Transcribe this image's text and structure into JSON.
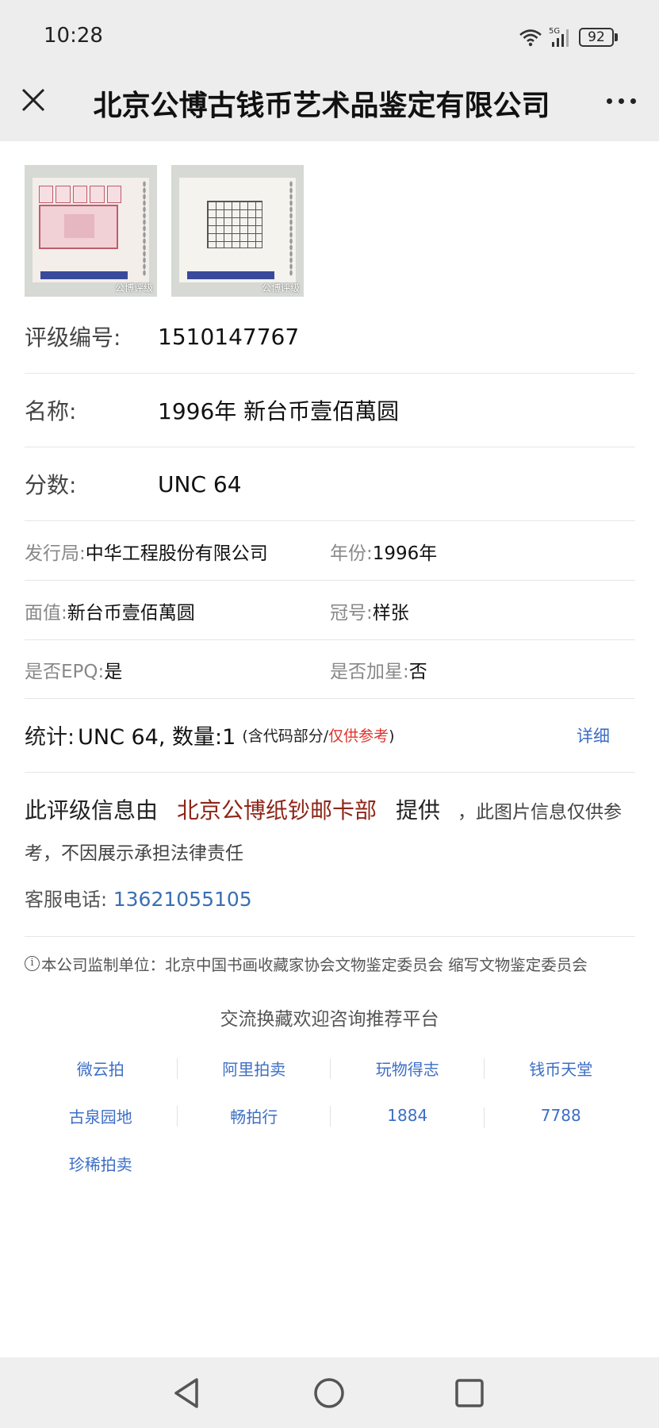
{
  "status_bar": {
    "time": "10:28",
    "network": "5G",
    "battery": "92"
  },
  "nav": {
    "title": "北京公博古钱币艺术品鉴定有限公司",
    "close_icon": "close-icon",
    "more_icon": "more-icon"
  },
  "thumbnails": [
    {
      "watermark": "公博评级"
    },
    {
      "watermark": "公博评级"
    }
  ],
  "main": {
    "grade_no_label": "评级编号:",
    "grade_no": "1510147767",
    "name_label": "名称:",
    "name": "1996年 新台币壹佰萬圆",
    "score_label": "分数:",
    "score": "UNC 64"
  },
  "details": {
    "issuer_label": "发行局:",
    "issuer": "中华工程股份有限公司",
    "year_label": "年份:",
    "year": "1996年",
    "denom_label": "面值:",
    "denom": "新台币壹佰萬圆",
    "serial_label": "冠号:",
    "serial": "样张",
    "epq_label": "是否EPQ:",
    "epq": "是",
    "star_label": "是否加星:",
    "star": "否"
  },
  "stats": {
    "label": "统计:",
    "value": "UNC 64, 数量:1",
    "paren_open": "(含代码部分/",
    "paren_red": "仅供参考",
    "paren_close": ")",
    "detail_link": "详细"
  },
  "provider": {
    "prefix": "此评级信息由",
    "name": "北京公博纸钞邮卡部",
    "provided": "提供",
    "suffix": "，此图片信息仅供参考，不因展示承担法律责任",
    "phone_label": "客服电话:",
    "phone": "13621055105"
  },
  "supervise": {
    "text": "本公司监制单位：北京中国书画收藏家协会文物鉴定委员会 缩写文物鉴定委员会"
  },
  "platforms": {
    "title": "交流换藏欢迎咨询推荐平台",
    "items": [
      "微云拍",
      "阿里拍卖",
      "玩物得志",
      "钱币天堂",
      "古泉园地",
      "畅拍行",
      "1884",
      "7788",
      "珍稀拍卖"
    ]
  },
  "colors": {
    "link": "#3d6ec5",
    "provider_name": "#8e2518",
    "red_note": "#e0302a",
    "header_bg": "#ededed"
  }
}
